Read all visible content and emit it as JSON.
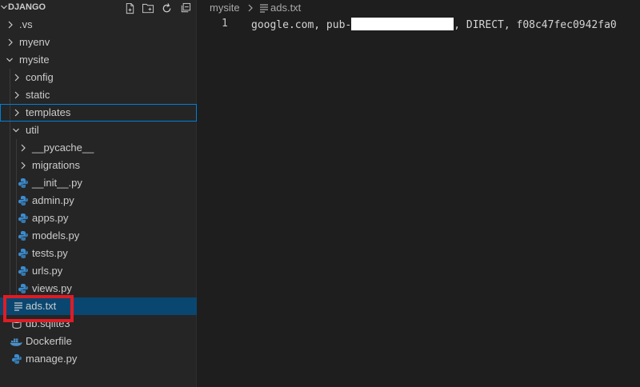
{
  "explorer": {
    "title": "DJANGO",
    "actions": [
      "new-file-icon",
      "new-folder-icon",
      "refresh-icon",
      "collapse-all-icon"
    ],
    "items": [
      {
        "label": ".vs",
        "type": "folder",
        "expanded": false
      },
      {
        "label": "myenv",
        "type": "folder",
        "expanded": false
      },
      {
        "label": "mysite",
        "type": "folder",
        "expanded": true
      },
      {
        "label": "config",
        "type": "folder",
        "expanded": false
      },
      {
        "label": "static",
        "type": "folder",
        "expanded": false
      },
      {
        "label": "templates",
        "type": "folder",
        "expanded": false
      },
      {
        "label": "util",
        "type": "folder",
        "expanded": true
      },
      {
        "label": "__pycache__",
        "type": "folder",
        "expanded": false
      },
      {
        "label": "migrations",
        "type": "folder",
        "expanded": false
      },
      {
        "label": "__init__.py",
        "type": "python"
      },
      {
        "label": "admin.py",
        "type": "python"
      },
      {
        "label": "apps.py",
        "type": "python"
      },
      {
        "label": "models.py",
        "type": "python"
      },
      {
        "label": "tests.py",
        "type": "python"
      },
      {
        "label": "urls.py",
        "type": "python"
      },
      {
        "label": "views.py",
        "type": "python"
      },
      {
        "label": "ads.txt",
        "type": "text"
      },
      {
        "label": "db.sqlite3",
        "type": "database"
      },
      {
        "label": "Dockerfile",
        "type": "docker"
      },
      {
        "label": "manage.py",
        "type": "python"
      }
    ]
  },
  "editor": {
    "breadcrumb": {
      "folder": "mysite",
      "file": "ads.txt"
    },
    "lines": [
      {
        "number": "1",
        "before": "google.com, pub-",
        "after": ", DIRECT, f08c47fec0942fa0"
      }
    ]
  },
  "colors": {
    "selection": "#094771",
    "focus_outline": "#007fd4",
    "python_icon": "#3b8ccf",
    "docker_icon": "#4a90c8",
    "highlight_box": "#e01b24"
  }
}
